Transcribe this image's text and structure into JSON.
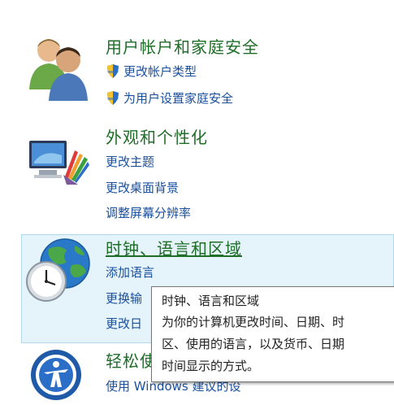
{
  "categories": [
    {
      "title": "用户帐户和家庭安全",
      "links": [
        "更改帐户类型",
        "为用户设置家庭安全"
      ]
    },
    {
      "title": "外观和个性化",
      "links": [
        "更改主题",
        "更改桌面背景",
        "调整屏幕分辨率"
      ]
    },
    {
      "title": "时钟、语言和区域",
      "links": [
        "添加语言",
        "更换输",
        "更改日"
      ]
    },
    {
      "title": "轻松使",
      "links": [
        "使用 Windows 建议的设"
      ]
    }
  ],
  "tooltip": {
    "lines": [
      "时钟、语言和区域",
      "为你的计算机更改时间、日期、时",
      "区、使用的语言，以及货币、日期",
      "时间显示的方式。"
    ]
  }
}
